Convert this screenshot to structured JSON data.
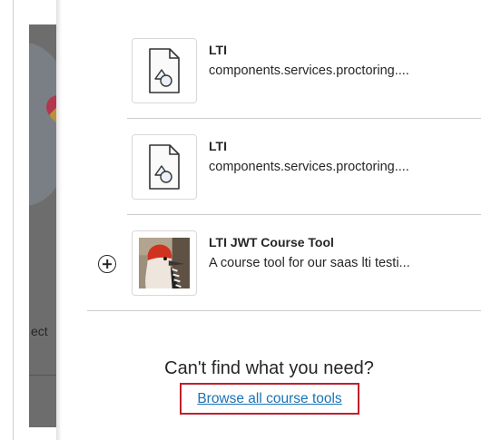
{
  "backdrop": {
    "visible_text": "ect"
  },
  "tools": [
    {
      "title": "LTI",
      "description": "components.services.proctoring....",
      "icon": "generic-file-icon",
      "has_add_button": false
    },
    {
      "title": "LTI",
      "description": "components.services.proctoring....",
      "icon": "generic-file-icon",
      "has_add_button": false
    },
    {
      "title": "LTI JWT Course Tool",
      "description": "A course tool for our saas lti testi...",
      "icon": "woodpecker-image",
      "has_add_button": true
    }
  ],
  "footer": {
    "prompt": "Can't find what you need?",
    "browse_link": "Browse all course tools"
  },
  "colors": {
    "link": "#1a73b5",
    "highlight_box": "#c01f2f",
    "backdrop": "#6d6d6d",
    "text": "#262626"
  }
}
